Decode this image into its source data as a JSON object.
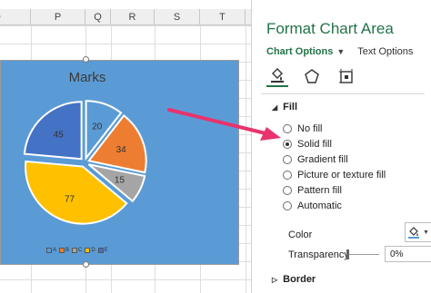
{
  "sheet": {
    "columns": [
      "O",
      "P",
      "Q",
      "R",
      "S",
      "T"
    ]
  },
  "chart": {
    "title": "Marks",
    "slices": [
      {
        "label": "20",
        "value": 20,
        "color": "#5b9bd5"
      },
      {
        "label": "34",
        "value": 34,
        "color": "#ed7d31"
      },
      {
        "label": "15",
        "value": 15,
        "color": "#a5a5a5"
      },
      {
        "label": "77",
        "value": 77,
        "color": "#ffc000"
      },
      {
        "label": "45",
        "value": 45,
        "color": "#4472c4"
      }
    ],
    "legend": [
      "A",
      "B",
      "C",
      "D",
      "E"
    ]
  },
  "chart_data": {
    "type": "pie",
    "title": "Marks",
    "categories": [
      "A",
      "B",
      "C",
      "D",
      "E"
    ],
    "values": [
      20,
      34,
      15,
      77,
      45
    ],
    "legend": "bottom"
  },
  "pane": {
    "title": "Format Chart Area",
    "tabs": {
      "chart_options": "Chart Options",
      "text_options": "Text Options"
    },
    "fill_section": "Fill",
    "fill_options": [
      {
        "label": "No fill",
        "checked": false
      },
      {
        "label": "Solid fill",
        "checked": true
      },
      {
        "label": "Gradient fill",
        "checked": false
      },
      {
        "label": "Picture or texture fill",
        "checked": false
      },
      {
        "label": "Pattern fill",
        "checked": false
      },
      {
        "label": "Automatic",
        "checked": false
      }
    ],
    "color_label": "Color",
    "transparency_label": "Transparency",
    "transparency_value": "0%",
    "border_section": "Border"
  },
  "colors": {
    "accent": "#217346",
    "arrow": "#e8336d",
    "chart_bg": "#5b9bd5"
  }
}
